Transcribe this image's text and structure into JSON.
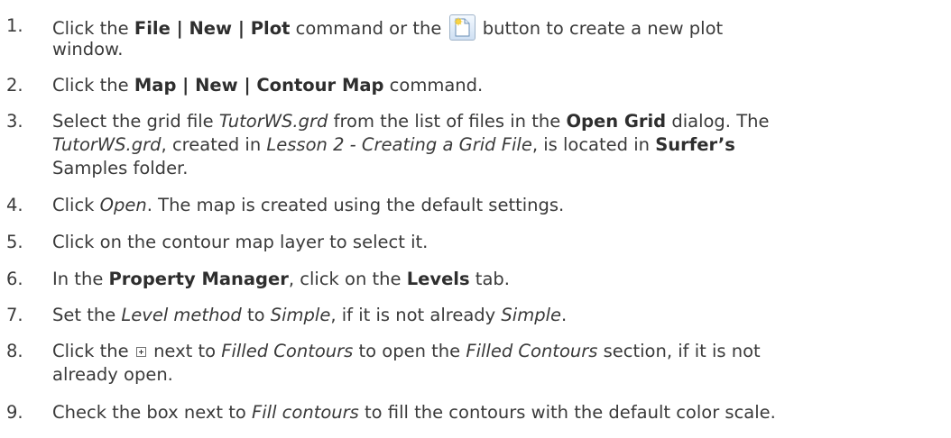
{
  "steps": [
    {
      "number": "1.",
      "lines": [
        [
          "Click the ",
          "File | New | Plot",
          " command or the ",
          "",
          " button to create a new plot"
        ],
        [
          "window."
        ]
      ]
    },
    {
      "number": "2.",
      "lines": [
        [
          "Click the ",
          "Map | New | Contour Map",
          " command."
        ]
      ]
    },
    {
      "number": "3.",
      "lines": [
        [
          "Select the grid file ",
          "TutorWS.grd",
          " from the list of files in the ",
          "Open Grid",
          " dialog. The"
        ],
        [
          "",
          "TutorWS.grd",
          ", created in ",
          "Lesson 2 - Creating a Grid File",
          ", is located in ",
          "Surfer’s"
        ],
        [
          "Samples folder."
        ]
      ]
    },
    {
      "number": "4.",
      "lines": [
        [
          "Click ",
          "Open",
          ". The map is created using the default settings."
        ]
      ]
    },
    {
      "number": "5.",
      "lines": [
        [
          "Click on the contour map layer to select it."
        ]
      ]
    },
    {
      "number": "6.",
      "lines": [
        [
          "In the ",
          "Property Manager",
          ", click on the ",
          "Levels",
          " tab."
        ]
      ]
    },
    {
      "number": "7.",
      "lines": [
        [
          "Set the ",
          "Level method",
          " to ",
          "Simple",
          ", if it is not already ",
          "Simple",
          "."
        ]
      ]
    },
    {
      "number": "8.",
      "lines": [
        [
          "Click the ",
          "",
          " next to ",
          "Filled Contours",
          " to open the ",
          "Filled Contours",
          " section, if it is not"
        ],
        [
          "already open."
        ]
      ]
    },
    {
      "number": "9.",
      "lines": [
        [
          "Check the box next to ",
          "Fill contours",
          " to fill the contours with the default color scale."
        ]
      ]
    }
  ],
  "icons": {
    "new_plot_button": "new-document-icon",
    "expand_button": "plus-box-icon"
  }
}
